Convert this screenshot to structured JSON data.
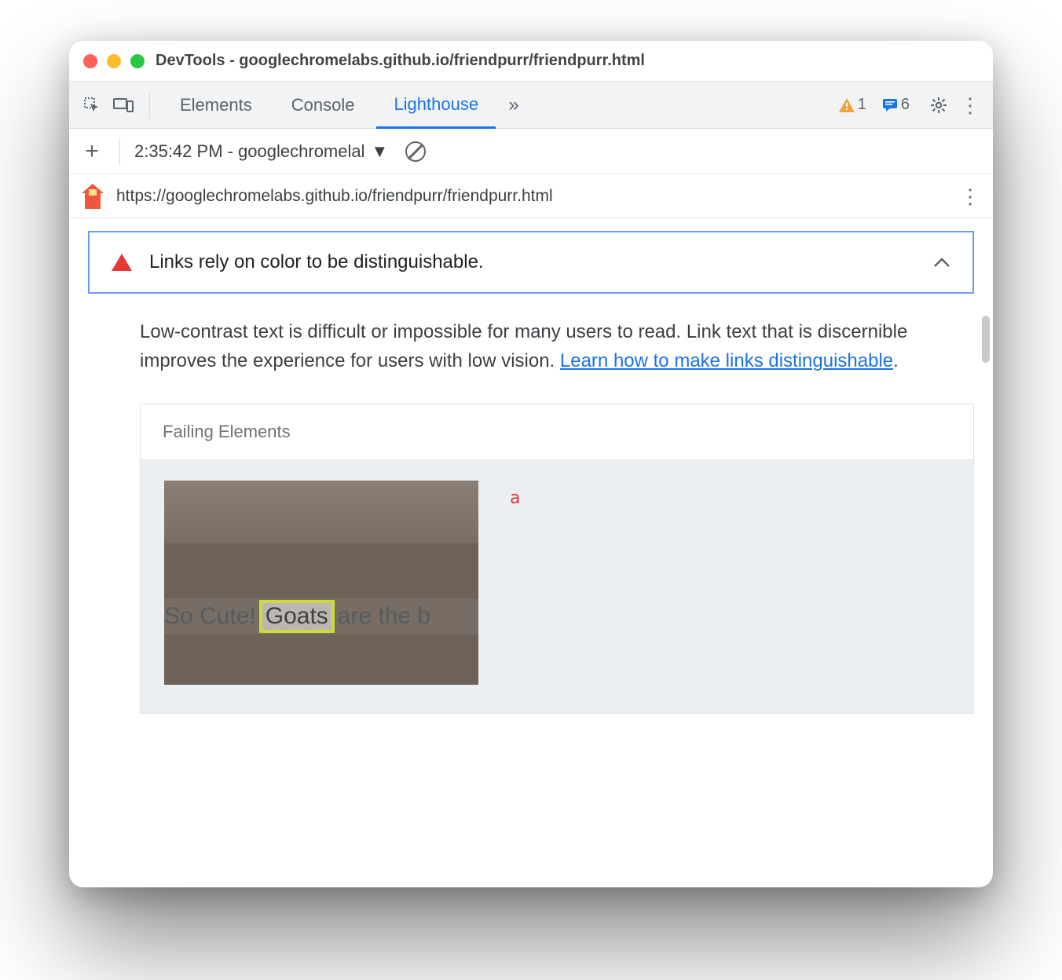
{
  "window": {
    "title": "DevTools - googlechromelabs.github.io/friendpurr/friendpurr.html"
  },
  "tabs": {
    "elements": "Elements",
    "console": "Console",
    "lighthouse": "Lighthouse"
  },
  "counts": {
    "warnings": "1",
    "messages": "6"
  },
  "report_select": {
    "label": "2:35:42 PM - googlechromelal"
  },
  "url": "https://googlechromelabs.github.io/friendpurr/friendpurr.html",
  "audit": {
    "title": "Links rely on color to be distinguishable.",
    "description_pre": "Low-contrast text is difficult or impossible for many users to read. Link text that is discernible improves the experience for users with low vision. ",
    "learn_link": "Learn how to make links distinguishable",
    "description_post": "."
  },
  "failing": {
    "heading": "Failing Elements",
    "element_tag": "a",
    "thumb_text_left": "So Cute! ",
    "thumb_highlight": "Goats",
    "thumb_text_right": " are the b"
  }
}
